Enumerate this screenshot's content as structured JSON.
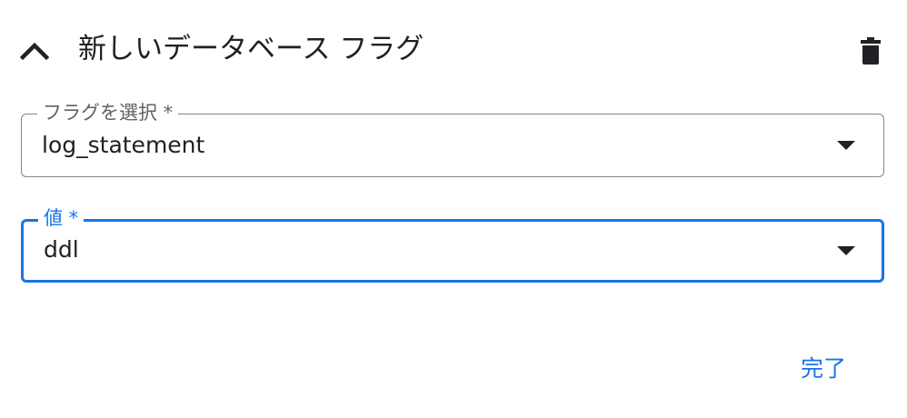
{
  "header": {
    "title": "新しいデータベース フラグ",
    "collapse_icon": "chevron-up-icon",
    "delete_icon": "trash-icon"
  },
  "flag_field": {
    "label": "フラグを選択 *",
    "value": "log_statement",
    "dropdown_icon": "dropdown-arrow-icon"
  },
  "value_field": {
    "label": "値 *",
    "value": "ddl",
    "dropdown_icon": "dropdown-arrow-icon"
  },
  "actions": {
    "done_label": "完了"
  },
  "colors": {
    "accent": "#1a73e8",
    "text": "#202124",
    "muted": "#5f6368",
    "border": "#80868b"
  }
}
